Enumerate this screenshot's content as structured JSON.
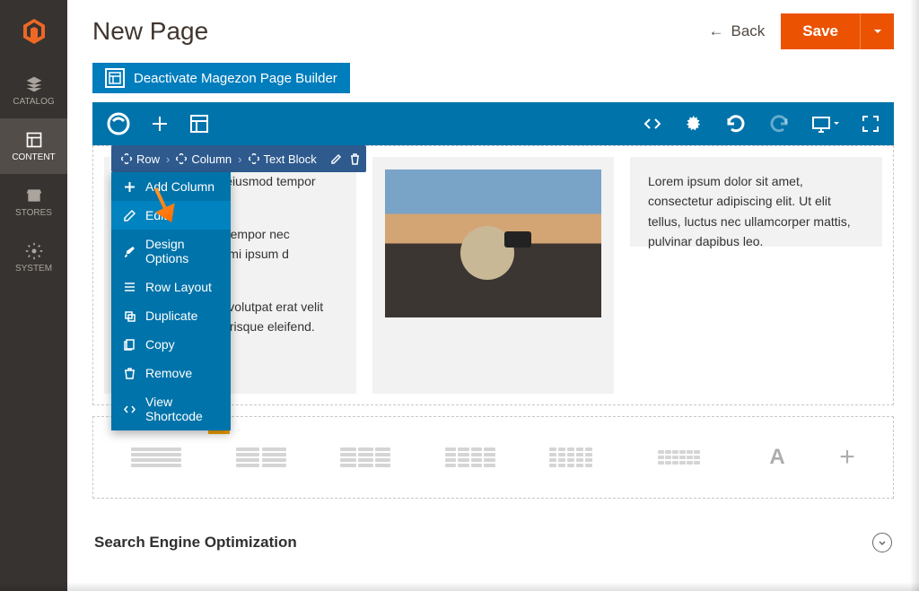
{
  "header": {
    "title": "New Page",
    "back": "Back",
    "save": "Save"
  },
  "sidebar": {
    "items": [
      {
        "id": "catalog",
        "label": "CATALOG"
      },
      {
        "id": "content",
        "label": "CONTENT"
      },
      {
        "id": "stores",
        "label": "STORES"
      },
      {
        "id": "system",
        "label": "SYSTEM"
      }
    ]
  },
  "builder": {
    "deactivate": "Deactivate Magezon Page Builder"
  },
  "breadcrumb": {
    "row": "Row",
    "column": "Column",
    "textblock": "Text Block"
  },
  "contextMenu": {
    "items": [
      {
        "icon": "plus",
        "label": "Add Column"
      },
      {
        "icon": "pencil",
        "label": "Edit"
      },
      {
        "icon": "brush",
        "label": "Design Options"
      },
      {
        "icon": "rows",
        "label": "Row Layout"
      },
      {
        "icon": "dup",
        "label": "Duplicate"
      },
      {
        "icon": "copy",
        "label": "Copy"
      },
      {
        "icon": "trash",
        "label": "Remove"
      },
      {
        "icon": "code",
        "label": "View Shortcode"
      }
    ]
  },
  "content": {
    "col1p1": "amet, consectetur eiusmod tempor dolore magna",
    "col1p2": "n nunc aliquet ssa tempor nec bibendum enim nc mi ipsum d ullamcorper.",
    "col1p3": "ectus magna enas volutpat erat velit egestas fringilla elerisque eleifend.",
    "col3": "Lorem ipsum dolor sit amet, consectetur adipiscing elit. Ut elit tellus, luctus nec ullamcorper mattis, pulvinar dapibus leo."
  },
  "seo": {
    "title": "Search Engine Optimization"
  }
}
